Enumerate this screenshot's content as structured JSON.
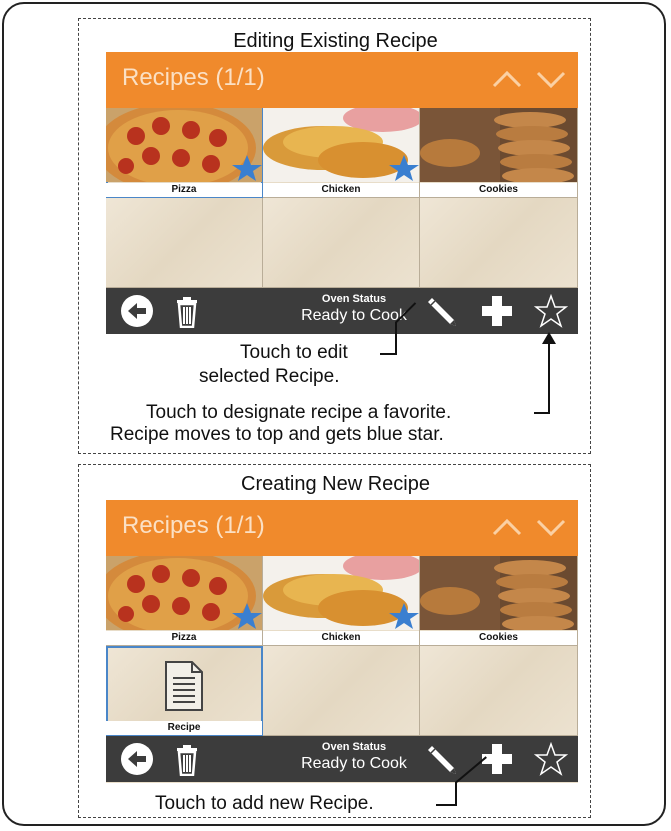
{
  "panel_top": {
    "title": "Editing Existing Recipe",
    "screen": {
      "header_title": "Recipes (1/1)",
      "tiles": [
        {
          "label": "Pizza",
          "favorite": true,
          "selected": true
        },
        {
          "label": "Chicken",
          "favorite": true,
          "selected": false
        },
        {
          "label": "Cookies",
          "favorite": false,
          "selected": false
        }
      ],
      "status_label": "Oven Status",
      "status_value": "Ready to Cook"
    },
    "callouts": {
      "edit_line1": "Touch to edit",
      "edit_line2": "selected Recipe.",
      "favorite_line1": "Touch to designate recipe a favorite.",
      "favorite_line2": "Recipe moves to top and gets blue star."
    }
  },
  "panel_bottom": {
    "title": "Creating New Recipe",
    "screen": {
      "header_title": "Recipes (1/1)",
      "tiles": [
        {
          "label": "Pizza",
          "favorite": true
        },
        {
          "label": "Chicken",
          "favorite": true
        },
        {
          "label": "Cookies",
          "favorite": false
        },
        {
          "label": "Recipe",
          "selected": true
        }
      ],
      "status_label": "Oven Status",
      "status_value": "Ready to Cook"
    },
    "callouts": {
      "add": "Touch to add new Recipe."
    }
  },
  "colors": {
    "header": "#f08a2c",
    "header_arrows": "#fbd0a3",
    "toolbar": "#3c3c3c",
    "favorite_star": "#3a7fd0",
    "selection": "#4a86c8"
  },
  "icons": [
    "back-icon",
    "trash-icon",
    "pencil-icon",
    "plus-icon",
    "star-outline-icon",
    "star-filled-icon",
    "document-icon",
    "chevron-up-icon",
    "chevron-down-icon"
  ]
}
